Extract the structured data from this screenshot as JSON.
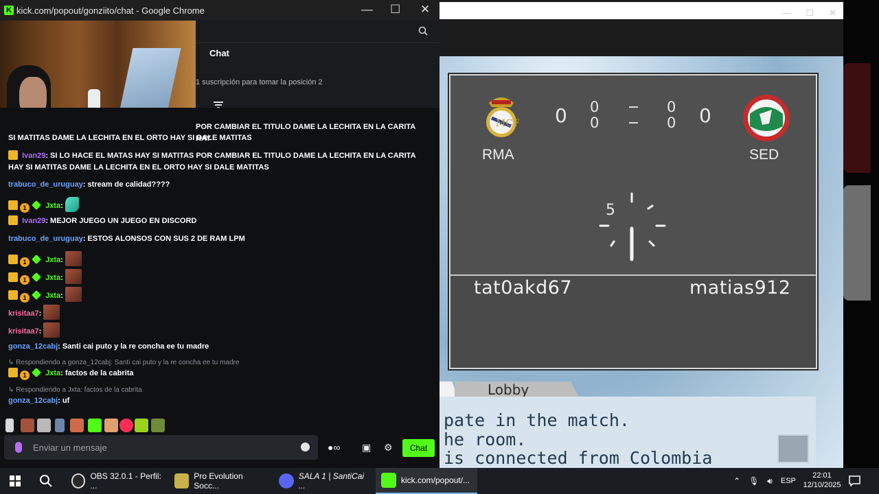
{
  "chrome": {
    "title": "kick.com/popout/gonziito/chat - Google Chrome",
    "minimize": "—",
    "maximize": "☐",
    "close": "✕"
  },
  "chat": {
    "header_title": "Chat",
    "subscription_notice": "1 suscripción para tomar la posición 2",
    "messages": [
      {
        "cont": "POR CAMBIAR EL TITULO DAME LA LECHITA EN LA CARITA HAY",
        "text": "SI MATITAS DAME LA LECHITA EN EL ORTO HAY SI DALE MATITAS"
      },
      {
        "user": "Ivan29",
        "text": "SI LO HACE EL MATAS HAY SI MATITAS POR CAMBIAR EL TITULO DAME LA LECHITA EN LA CARITA HAY SI MATITAS DAME LA LECHITA EN EL ORTO HAY SI DALE MATITAS"
      },
      {
        "user": "trabuco_de_uruguay",
        "text": "stream de calidad????"
      },
      {
        "user": "Jxta"
      },
      {
        "user": "Ivan29",
        "text": "MEJOR JUEGO UN JUEGO EN DISCORD"
      },
      {
        "user": "trabuco_de_uruguay",
        "text": "ESTOS ALONSOS CON SUS 2 DE RAM LPM"
      },
      {
        "user": "Jxta"
      },
      {
        "user": "Jxta"
      },
      {
        "user": "Jxta"
      },
      {
        "user": "krisitaa7"
      },
      {
        "user": "krisitaa7"
      },
      {
        "user": "gonza_12cabj",
        "text": "Santi cai puto y la re concha ee tu madre"
      },
      {
        "reply": "Respondiendo a gonza_12cabj: Santi cai puto y la re concha ee tu madre"
      },
      {
        "user": "Jxta",
        "text": "factos de la cabrita"
      },
      {
        "reply": "Respondiendo a Jxta: factos de la cabrita"
      },
      {
        "user": "gonza_12cabj",
        "text": "uf"
      }
    ],
    "input_placeholder": "Enviar un mensaje",
    "send_label": "Chat",
    "colors": {
      "ivan": "#b06cff",
      "trabuco": "#6aa4ff",
      "jxta": "#53fc18",
      "krisitaa": "#ff6b9a",
      "gonza": "#6aa4ff",
      "accent": "#53fc18"
    }
  },
  "game": {
    "home_abbr": "RMA",
    "away_abbr": "SED",
    "home_score": "0",
    "away_score": "0",
    "home_sub_top": "0",
    "home_sub_bottom": "0",
    "away_sub_top": "0",
    "away_sub_bottom": "0",
    "timer": "5",
    "player_left": "tat0akd67",
    "player_right": "matias912",
    "lobby_label": "Lobby",
    "message_lines": [
      "pate in the match.",
      "he room.",
      "is connected from Colombia"
    ]
  },
  "taskbar": {
    "items": [
      {
        "label": "OBS 32.0.1 - Perfil: ..."
      },
      {
        "label": "Pro Evolution Socc..."
      },
      {
        "label": "SALA 1 | SantiCai ..."
      },
      {
        "label": "kick.com/popout/..."
      }
    ],
    "language": "ESP",
    "time": "22:01",
    "date": "12/10/2025"
  }
}
